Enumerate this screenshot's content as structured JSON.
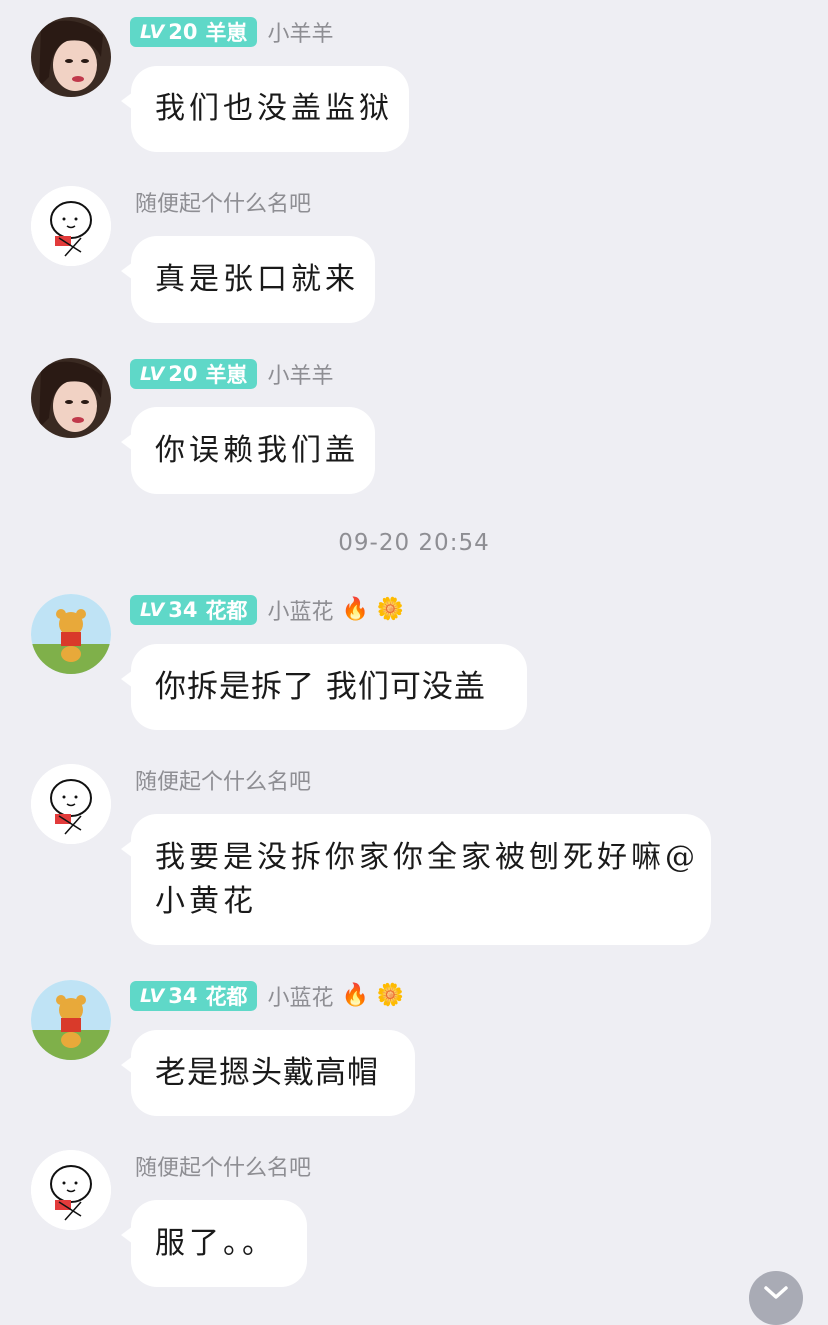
{
  "timestamp": "09-20 20:54",
  "messages": [
    {
      "avatar": "girl-avatar",
      "level": "LV",
      "level_num": "20",
      "group": "羊崽",
      "name": "小羊羊",
      "emoji": [
        "",
        ""
      ],
      "lines": [
        "我们也没盖监狱"
      ]
    },
    {
      "avatar": "doodle-avatar",
      "name": "随便起个什么名吧",
      "lines": [
        "真是张口就来"
      ]
    },
    {
      "avatar": "girl-avatar",
      "level": "LV",
      "level_num": "20",
      "group": "羊崽",
      "name": "小羊羊",
      "emoji": [
        "",
        ""
      ],
      "lines": [
        "你误赖我们盖"
      ]
    },
    {
      "avatar": "pooh-avatar",
      "level": "LV",
      "level_num": "34",
      "group": "花都",
      "name": "小蓝花",
      "emoji": [
        "🔥",
        "🌼"
      ],
      "lines": [
        "你拆是拆了 我们可没盖"
      ]
    },
    {
      "avatar": "doodle-avatar",
      "name": "随便起个什么名吧",
      "lines": [
        "我要是没拆你家你全家被刨死好嘛@",
        "小黄花"
      ]
    },
    {
      "avatar": "pooh-avatar",
      "level": "LV",
      "level_num": "34",
      "group": "花都",
      "name": "小蓝花",
      "emoji": [
        "🔥",
        "🌼"
      ],
      "lines": [
        "老是摁头戴高帽"
      ]
    },
    {
      "avatar": "doodle-avatar",
      "name": "随便起个什么名吧",
      "lines": [
        "服了。。"
      ]
    }
  ],
  "scroll_button_icon": "chevron-down-icon"
}
